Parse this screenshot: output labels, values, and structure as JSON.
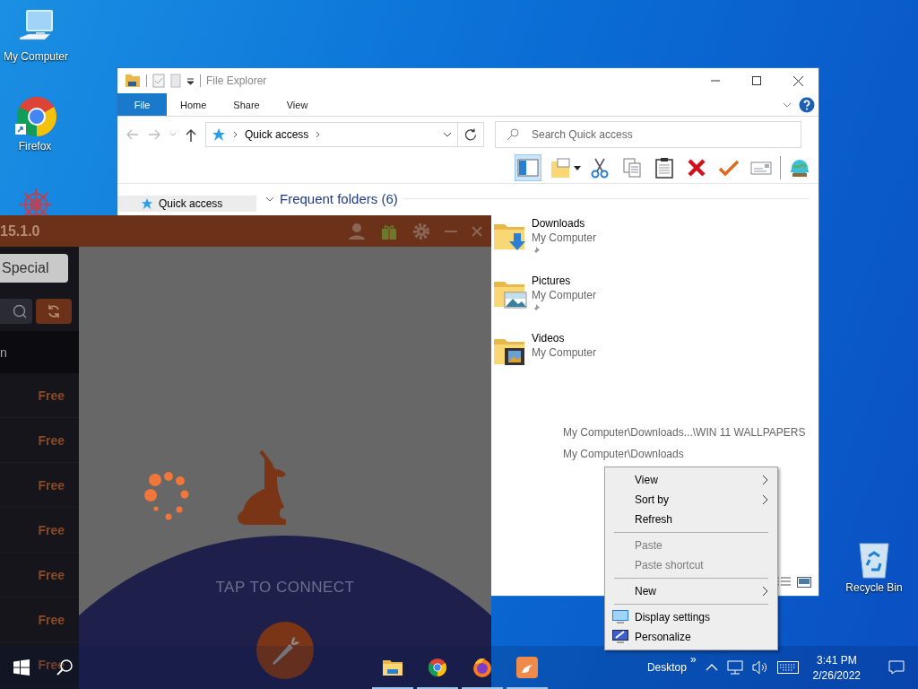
{
  "desktop_icons": [
    {
      "label": "My Computer"
    },
    {
      "label": "Firefox"
    },
    {
      "label": "Recycle Bin"
    }
  ],
  "file_explorer": {
    "title": "File Explorer",
    "ribbon_tabs": [
      {
        "label": "File",
        "selected": true
      },
      {
        "label": "Home",
        "selected": false
      },
      {
        "label": "Share",
        "selected": false
      },
      {
        "label": "View",
        "selected": false
      }
    ],
    "address": {
      "path": "Quick access"
    },
    "search": {
      "placeholder": "Search Quick access"
    },
    "preview_pane_button": {
      "selected": true
    },
    "nav_pane": [
      {
        "label": "Quick access",
        "selected": true
      }
    ],
    "section": {
      "title": "Frequent folders (6)",
      "expanded": true
    },
    "folders": [
      {
        "name": "Downloads",
        "location": "My Computer",
        "pinned": true
      },
      {
        "name": "Pictures",
        "location": "My Computer",
        "pinned": true
      },
      {
        "name": "Videos",
        "location": "My Computer",
        "pinned": false
      }
    ],
    "recent_paths": [
      "My Computer\\Downloads...\\WIN 11 WALLPAPERS",
      "My Computer\\Downloads"
    ]
  },
  "vpn_app": {
    "version": "15.1.0",
    "plan_button": "Special",
    "server_label": "n",
    "server_prices": [
      "Free",
      "Free",
      "Free",
      "Free",
      "Free",
      "Free",
      "Free"
    ],
    "connect_prompt": "TAP TO CONNECT"
  },
  "context_menu": {
    "items": [
      {
        "kind": "item",
        "label": "View",
        "submenu": true,
        "disabled": false
      },
      {
        "kind": "item",
        "label": "Sort by",
        "submenu": true,
        "disabled": false
      },
      {
        "kind": "item",
        "label": "Refresh",
        "submenu": false,
        "disabled": false
      },
      {
        "kind": "separator"
      },
      {
        "kind": "item",
        "label": "Paste",
        "submenu": false,
        "disabled": true
      },
      {
        "kind": "item",
        "label": "Paste shortcut",
        "submenu": false,
        "disabled": true
      },
      {
        "kind": "separator"
      },
      {
        "kind": "item",
        "label": "New",
        "submenu": true,
        "disabled": false
      },
      {
        "kind": "separator"
      },
      {
        "kind": "icon-item",
        "label": "Display settings",
        "submenu": false,
        "disabled": false
      },
      {
        "kind": "icon-item",
        "label": "Personalize",
        "submenu": false,
        "disabled": false
      }
    ]
  },
  "taskbar": {
    "apps": [
      {
        "running": true
      },
      {
        "running": true
      },
      {
        "running": true
      },
      {
        "running": true
      }
    ],
    "toolbar_label": "Desktop",
    "toolbar_more": "»",
    "time": "3:41 PM",
    "date": "2/26/2022"
  }
}
